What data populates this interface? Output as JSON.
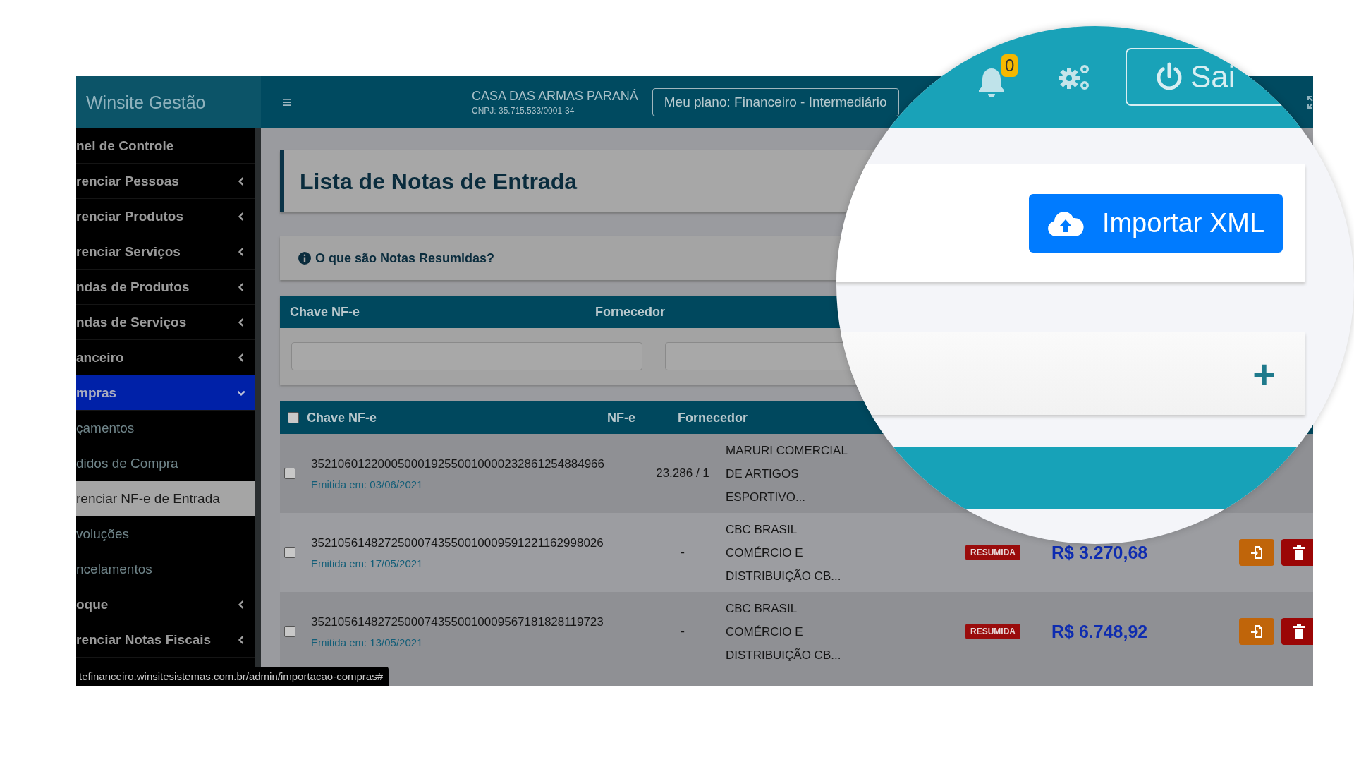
{
  "brand": "Winsite Gestão",
  "header": {
    "menu_glyph": "≡",
    "company": "CASA DAS ARMAS PARANÁ",
    "cnpj": "CNPJ: 35.715.533/0001-34",
    "plan": "Meu plano: Financeiro - Intermediário"
  },
  "sidebar": {
    "items": [
      {
        "kind": "group",
        "label": "nel de Controle",
        "selected": false
      },
      {
        "kind": "group",
        "label": "renciar Pessoas",
        "has_children": true,
        "expanded": false,
        "selected": false
      },
      {
        "kind": "group",
        "label": "renciar Produtos",
        "has_children": true,
        "expanded": false,
        "selected": false
      },
      {
        "kind": "group",
        "label": "renciar Serviços",
        "has_children": true,
        "expanded": false,
        "selected": false
      },
      {
        "kind": "group",
        "label": "ndas de Produtos",
        "has_children": true,
        "expanded": false,
        "selected": false
      },
      {
        "kind": "group",
        "label": "ndas de Serviços",
        "has_children": true,
        "expanded": false,
        "selected": false
      },
      {
        "kind": "group",
        "label": "anceiro",
        "has_children": true,
        "expanded": false,
        "selected": false
      },
      {
        "kind": "group",
        "label": "mpras",
        "has_children": true,
        "expanded": true,
        "selected": true
      },
      {
        "kind": "sub",
        "label": "çamentos",
        "selected": false
      },
      {
        "kind": "sub",
        "label": "didos de Compra",
        "selected": false
      },
      {
        "kind": "sub",
        "label": "renciar NF-e de Entrada",
        "selected": true
      },
      {
        "kind": "sub",
        "label": "voluções",
        "selected": false
      },
      {
        "kind": "sub",
        "label": "ncelamentos",
        "selected": false
      },
      {
        "kind": "group",
        "label": "oque",
        "has_children": true,
        "expanded": false,
        "selected": false
      },
      {
        "kind": "group",
        "label": "renciar Notas Fiscais",
        "has_children": true,
        "expanded": false,
        "selected": false
      }
    ]
  },
  "page_title": "Lista de Notas de Entrada",
  "info_link": "O que são Notas Resumidas?",
  "filters": [
    {
      "label": "Chave NF-e"
    },
    {
      "label": "Fornecedor"
    }
  ],
  "table": {
    "select_all_checked": false,
    "columns": [
      "Chave NF-e",
      "NF-e",
      "Fornecedor"
    ],
    "rows": [
      {
        "checked": false,
        "key": "35210601220005000192550010000232861254884966",
        "issued": "Emitida em: 03/06/2021",
        "number": "23.286 / 1",
        "supplier": "MARURI COMERCIAL\nDE ARTIGOS\nESPORTIVO..."
      },
      {
        "checked": false,
        "key": "35210561482725000743550010009591221162998026",
        "issued": "Emitida em: 17/05/2021",
        "number": "-",
        "supplier": "CBC BRASIL\nCOMÉRCIO E\nDISTRIBUIÇÃO CB...",
        "badge": "RESUMIDA",
        "value": "R$ 3.270,68"
      },
      {
        "checked": false,
        "key": "35210561482725000743550010009567181828119723",
        "issued": "Emitida em: 13/05/2021",
        "number": "-",
        "supplier": "CBC BRASIL\nCOMÉRCIO E\nDISTRIBUIÇÃO CB...",
        "badge": "RESUMIDA",
        "value": "R$ 6.748,92"
      }
    ]
  },
  "status_url": "tefinanceiro.winsitesistemas.com.br/admin/importacao-compras#",
  "magnifier": {
    "notifications": "0",
    "logout": "Sai",
    "import_button": "Importar XML",
    "add_glyph": "+"
  }
}
